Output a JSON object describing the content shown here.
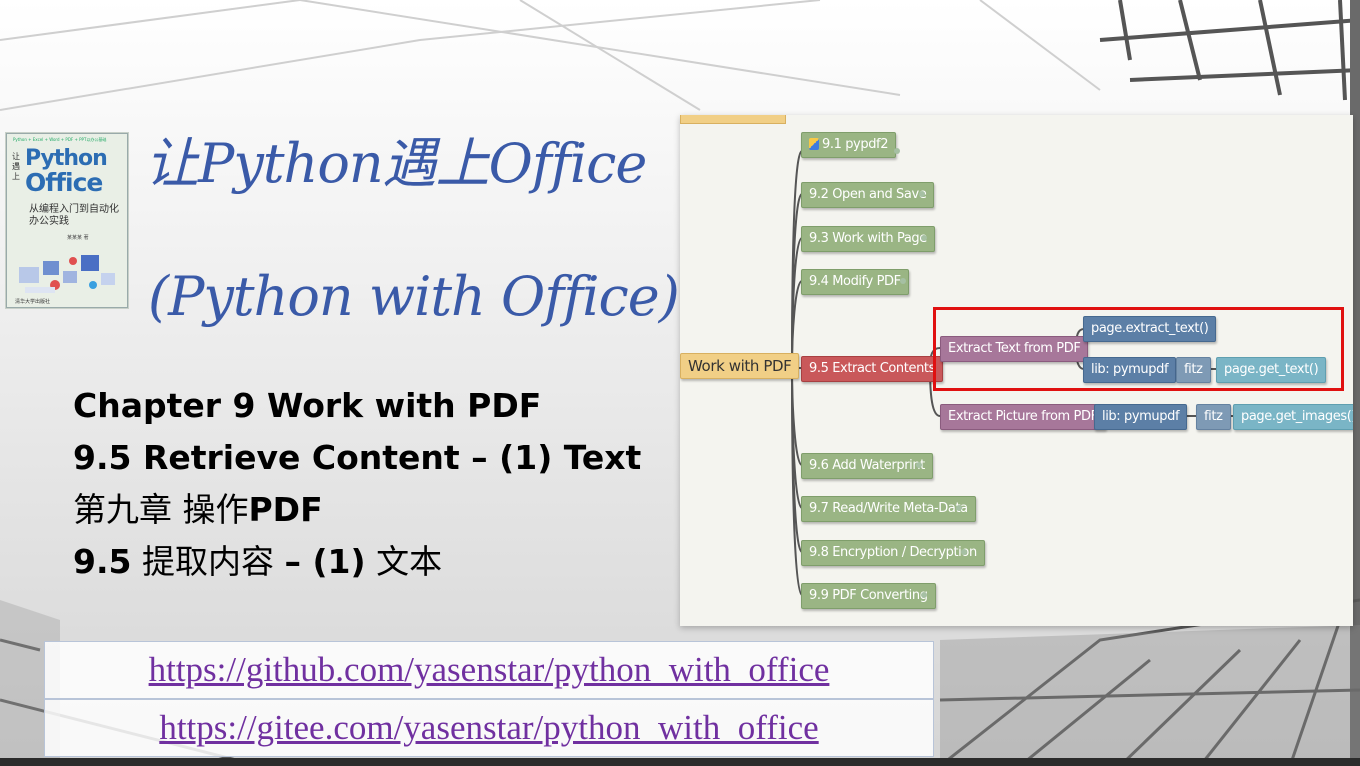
{
  "book": {
    "top_line": "Python + Excel + Word + PDF + PPT以办公基础",
    "side_text": "让遇上",
    "python": "Python",
    "office": "Office",
    "subtitle": "从编程入门到自动化办公实践",
    "author": "某某某 著",
    "publisher": "清华大学出版社"
  },
  "title": {
    "cn": "让Python遇上Office",
    "en": "(Python with Office)"
  },
  "chapter": {
    "line1": "Chapter 9 Work with PDF",
    "line2": "9.5 Retrieve Content – (1) Text",
    "line3_cn": "第九章 操作",
    "line3_bold": "PDF",
    "line4_num": "9.5",
    "line4_cn": " 提取内容 ",
    "line4_bold": "– (1)",
    "line4_end": " 文本"
  },
  "links": {
    "github": "https://github.com/yasenstar/python_with_office",
    "gitee": "https://gitee.com/yasenstar/python_with_office"
  },
  "mindmap": {
    "root": "Work with PDF",
    "sections": [
      "9.1 pypdf2",
      "9.2 Open and Save",
      "9.3 Work with Page",
      "9.4 Modify PDF",
      "9.5 Extract Contents",
      "9.6 Add Waterprint",
      "9.7 Read/Write Meta-Data",
      "9.8 Encryption / Decryption",
      "9.9 PDF Converting"
    ],
    "extract_text": "Extract Text from PDF",
    "extract_picture": "Extract Picture from PDF",
    "page_extract_text": "page.extract_text()",
    "lib_pymupdf": "lib: pymupdf",
    "fitz": "fitz",
    "page_get_text": "page.get_text()",
    "page_get_images": "page.get_images()"
  },
  "colors": {
    "title_blue": "#3a5aa8",
    "link_purple": "#7030a0",
    "highlight_red": "#e01010"
  }
}
